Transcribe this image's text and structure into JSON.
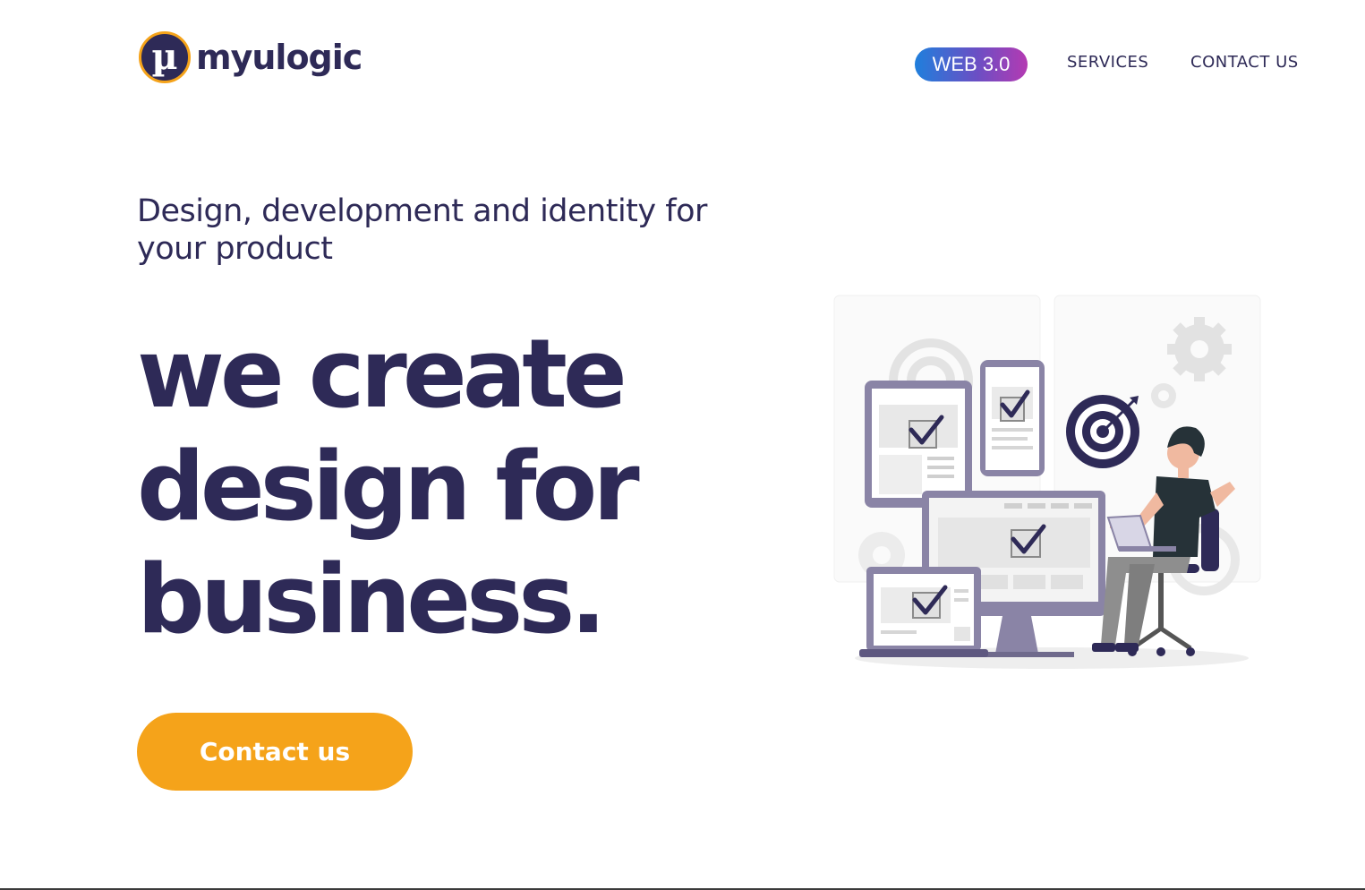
{
  "brand": {
    "logo_glyph": "µ",
    "name": "myulogic"
  },
  "nav": {
    "web3_label": "WEB 3.0",
    "services_label": "SERVICES",
    "contact_label": "CONTACT US"
  },
  "hero": {
    "subtitle": "Design, development and identity for your product",
    "headline_lines": [
      "we create",
      "design for",
      "business."
    ],
    "cta_label": "Contact us"
  },
  "colors": {
    "primary": "#2e2a57",
    "accent": "#f5a31a",
    "badge_gradient": [
      "#1f7fdc",
      "#b43ab2"
    ]
  },
  "icons": {
    "illustration": "designer-at-desk-illustration",
    "target": "target-icon",
    "gear": "gear-icon",
    "check": "checkmark-icon"
  }
}
